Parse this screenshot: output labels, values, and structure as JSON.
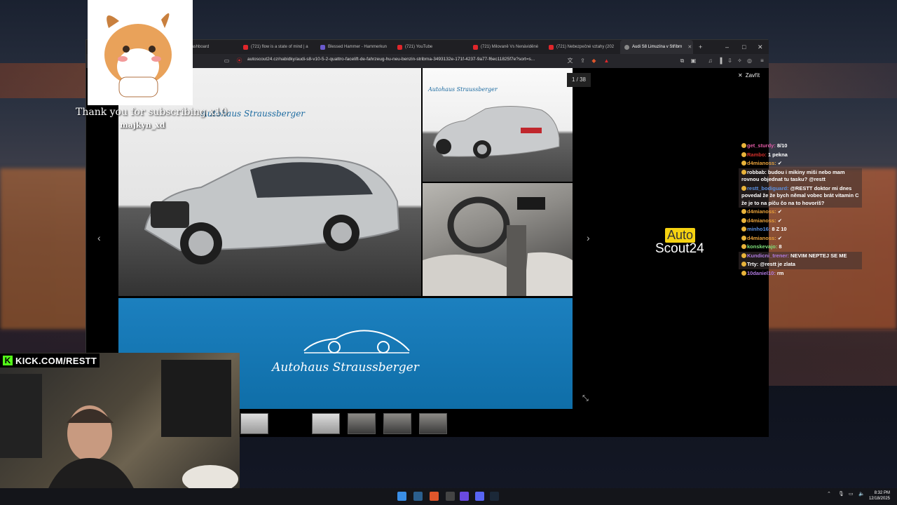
{
  "browser": {
    "tabs": [
      {
        "label": "Dashboard",
        "active": false
      },
      {
        "label": "(721) flow is a state of mind | a",
        "active": false
      },
      {
        "label": "Blessed Hammer - Hammerkun",
        "active": false
      },
      {
        "label": "(721) YouTube",
        "active": false
      },
      {
        "label": "(721) Milovaně Vs Nenáviděné",
        "active": false
      },
      {
        "label": "(721) Nebezpečné vztahy (202",
        "active": false
      },
      {
        "label": "Audi S8 Limuzína v Stříbrn",
        "active": true
      }
    ],
    "new_tab": "+",
    "window_controls": {
      "minimize": "–",
      "maximize": "□",
      "close": "✕"
    },
    "url": "autoscout24.cz/nabidky/audi-s8-v10-5-2-quattro-facelift-de-fahrzeug-hu-neu-benzin-stribrna-3493132e-171f-4237-9a77-f6ec11825f7e?sort=s..."
  },
  "gallery": {
    "counter": "1 / 38",
    "close_label": "Zavřít",
    "dealer_name": "Autohaus Straussberger",
    "dealer_name_small": "Autohaus Straussberger",
    "brand_top": "Auto",
    "brand_bottom": "Scout24"
  },
  "chat": {
    "messages": [
      {
        "user": "get_sturdy:",
        "text": "8/10",
        "color": "#e05aa5",
        "highlight": false
      },
      {
        "user": "Rambo:",
        "text": "1 pekna",
        "color": "#d4302b",
        "highlight": false
      },
      {
        "user": "d4mianoss:",
        "text": "✔",
        "color": "#e8a13a",
        "highlight": false
      },
      {
        "user": "robbab:",
        "text": "budou i mikiny miši nebo mam rovnou objednat tu tasku? @restt",
        "color": "#ffffff",
        "highlight": true
      },
      {
        "user": "restt_bodiguard:",
        "text": "@RESTT doktor mi dnes povedal že že bych němal vobec brát vitamin C že je to na píču čo na to hovoríš?",
        "color": "#5a8fe0",
        "highlight": true
      },
      {
        "user": "d4mianoss:",
        "text": "✔",
        "color": "#e8a13a",
        "highlight": false
      },
      {
        "user": "d4mianoss:",
        "text": "✔",
        "color": "#e8a13a",
        "highlight": false
      },
      {
        "user": "minho16:",
        "text": "8 Z 10",
        "color": "#5a8fe0",
        "highlight": false
      },
      {
        "user": "d4mianoss:",
        "text": "✔",
        "color": "#e8a13a",
        "highlight": false
      },
      {
        "user": "konskevajo:",
        "text": "8",
        "color": "#7fe07a",
        "highlight": false
      },
      {
        "user": "Kundicni_trener:",
        "text": "NEVIM NEPTEJ SE ME",
        "color": "#b07ae0",
        "highlight": true
      },
      {
        "user": "Trty:",
        "text": "@restt je zlata",
        "color": "#ffffff",
        "highlight": true
      },
      {
        "user": "10daniel10:",
        "text": "rm",
        "color": "#b07ae0",
        "highlight": false
      }
    ]
  },
  "overlay": {
    "sub_text": "Thank you for subscribing x10",
    "sub_user": "majkyn_xd",
    "kick_url": "KICK.COM/RESTT"
  },
  "taskbar": {
    "time": "8:32 PM",
    "date": "12/18/2025"
  }
}
